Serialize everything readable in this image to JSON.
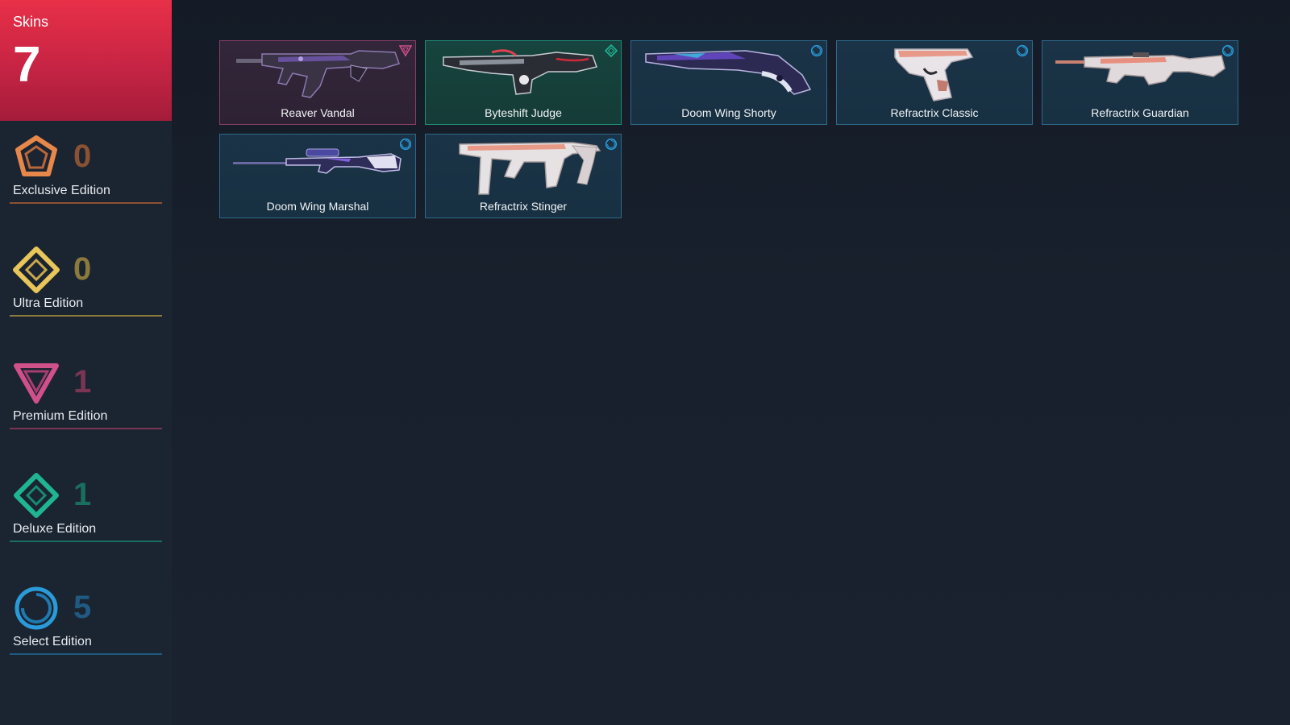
{
  "summary": {
    "label": "Skins",
    "count": "7"
  },
  "tiers": [
    {
      "key": "exclusive",
      "label": "Exclusive Edition",
      "count": "0",
      "icon": "exclusive-edition-icon",
      "color": "#e8874a",
      "count_color": "#8a5233"
    },
    {
      "key": "ultra",
      "label": "Ultra Edition",
      "count": "0",
      "icon": "ultra-edition-icon",
      "color": "#e8c65a",
      "count_color": "#8c7a3c"
    },
    {
      "key": "premium",
      "label": "Premium Edition",
      "count": "1",
      "icon": "premium-edition-icon",
      "color": "#d0508a",
      "count_color": "#7a3554"
    },
    {
      "key": "deluxe",
      "label": "Deluxe Edition",
      "count": "1",
      "icon": "deluxe-edition-icon",
      "color": "#1fb594",
      "count_color": "#1a6e60"
    },
    {
      "key": "select",
      "label": "Select Edition",
      "count": "5",
      "icon": "select-edition-icon",
      "color": "#2a9ad8",
      "count_color": "#1f5a82"
    }
  ],
  "skins": [
    {
      "name": "Reaver Vandal",
      "tier": "premium",
      "weapon": "rifle",
      "palette": "violet"
    },
    {
      "name": "Byteshift Judge",
      "tier": "deluxe",
      "weapon": "shotgun",
      "palette": "chrome"
    },
    {
      "name": "Doom Wing Shorty",
      "tier": "select",
      "weapon": "shorty",
      "palette": "galaxy"
    },
    {
      "name": "Refractrix Classic",
      "tier": "select",
      "weapon": "pistol",
      "palette": "rose"
    },
    {
      "name": "Refractrix Guardian",
      "tier": "select",
      "weapon": "guardian",
      "palette": "rose"
    },
    {
      "name": "Doom Wing Marshal",
      "tier": "select",
      "weapon": "sniper",
      "palette": "galaxy"
    },
    {
      "name": "Refractrix Stinger",
      "tier": "select",
      "weapon": "smg",
      "palette": "rose"
    }
  ]
}
